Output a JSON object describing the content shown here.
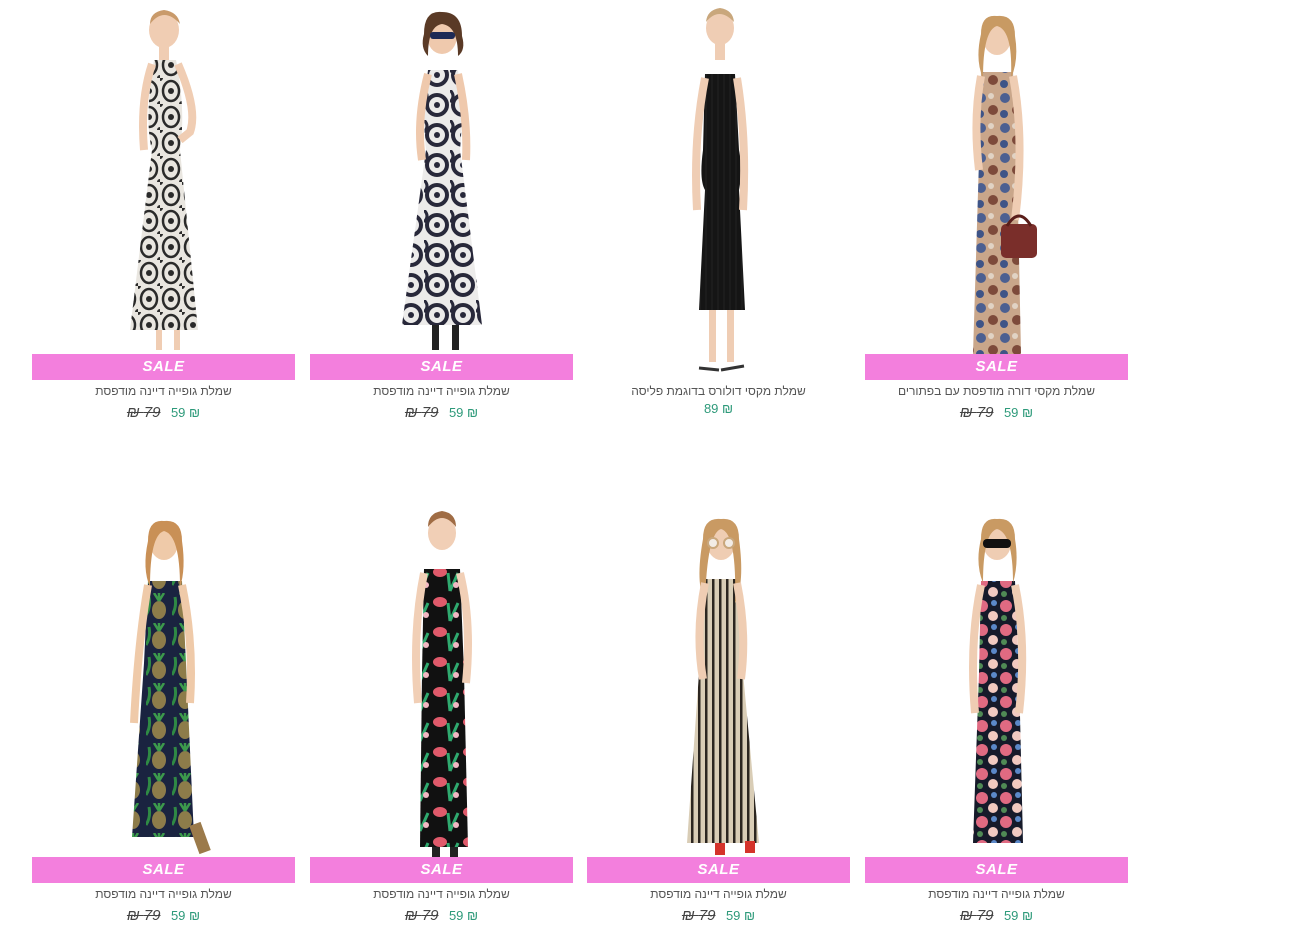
{
  "colors": {
    "sale_bg": "#f37fdd",
    "price_new": "#2e9a7a",
    "price_old": "#444444"
  },
  "products": [
    {
      "title": "שמלת גופייה דיינה מודפסת",
      "price": "₪ 59",
      "old_price": "79 ₪",
      "sale": "SALE",
      "pattern": "damask"
    },
    {
      "title": "שמלת גופייה דיינה מודפסת",
      "price": "₪ 59",
      "old_price": "79 ₪",
      "sale": "SALE",
      "pattern": "paisley"
    },
    {
      "title": "שמלת מקסי דולורס בדוגמת פליסה",
      "price": "₪ 89",
      "old_price": "",
      "sale": "",
      "pattern": "black"
    },
    {
      "title": "שמלת מקסי דורה מודפסת עם בפתורים",
      "price": "₪ 59",
      "old_price": "79 ₪",
      "sale": "SALE",
      "pattern": "floral-blue"
    },
    {
      "title": "שמלת גופייה דיינה מודפסת",
      "price": "₪ 59",
      "old_price": "79 ₪",
      "sale": "SALE",
      "pattern": "pineapple"
    },
    {
      "title": "שמלת גופייה דיינה מודפסת",
      "price": "₪ 59",
      "old_price": "79 ₪",
      "sale": "SALE",
      "pattern": "tropical"
    },
    {
      "title": "שמלת גופייה דיינה מודפסת",
      "price": "₪ 59",
      "old_price": "79 ₪",
      "sale": "SALE",
      "pattern": "stripes"
    },
    {
      "title": "שמלת גופייה דיינה מודפסת",
      "price": "₪ 59",
      "old_price": "79 ₪",
      "sale": "SALE",
      "pattern": "roses"
    }
  ]
}
